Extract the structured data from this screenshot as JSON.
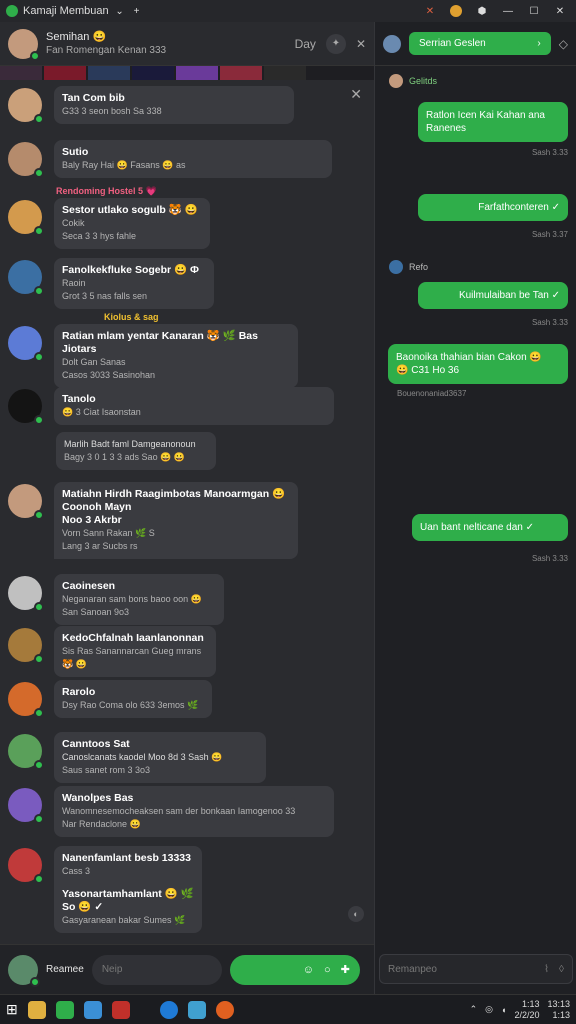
{
  "titlebar": {
    "title": "Kamaji Membuan"
  },
  "left_header": {
    "name": "Semihan 😀",
    "status": "Fan Romengan Kenan 333",
    "day_label": "Day"
  },
  "chats": [
    {
      "name": "Tan Com bib",
      "meta": "G33 3 seon bosh Sa 338",
      "avatar_color": "#caa07a"
    },
    {
      "name": "Sutio",
      "meta": "Baly  Ray Hai 😀 Fasans 😀 as",
      "avatar_color": "#b58b6c"
    },
    {
      "label": "Rendoming Hostel 5 💗"
    },
    {
      "name": "Sestor utlako sogulb 🐯 😀",
      "meta": "Cokik",
      "meta2": "Seca 3 3 hys fahle",
      "avatar_color": "#d39a4d"
    },
    {
      "name": "Fanolkekfluke Sogebr 😀 Ф",
      "meta": "Raoin",
      "meta2": "Grot 3 5 nas falls sen",
      "avatar_color": "#3b6fa3"
    },
    {
      "label": "Kiolus & sag"
    },
    {
      "name": "Ratian mlam yentar Kanaran 🐯 🌿 Bas Jiotars",
      "meta": "Dolt Gan Sanas",
      "meta2": "Casos 3033 Sasinohan",
      "avatar_color": "#5c7bd6"
    },
    {
      "name": "Tanolo",
      "meta": "😀 3 Ciat Isaonstan",
      "avatar_color": "#141414"
    },
    {
      "name": "Marlih Badt faml Damgeanonoun",
      "meta": "Bagy 3 0 1 3 3 ads Sao 😀 😀"
    },
    {
      "name": "Matiahn Hirdh Raagimbotas Manoarmgan 😀",
      "meta": "Coonoh Mayn",
      "meta2": "Noo 3 Akrbr",
      "meta3": "Vorn Sann Rakan 🌿 S",
      "meta4": "Lang 3 ar Sucbs rs",
      "avatar_color": "#c39a7d"
    },
    {
      "name": "Caoinesen",
      "meta": "Neganaran sam bons baoo oon 😀",
      "meta2": "San Sanoan 9o3",
      "avatar_color": "#c0c0c0"
    },
    {
      "name": "KedoChfalnah Iaanlanonnan",
      "meta": "Sis Ras Sanannarcan Gueg mrans 🐯 😀",
      "avatar_color": "#a57a3b"
    },
    {
      "name": "Rarolo",
      "meta": "Dsy  Rao  Coma olo 633 3emos 🌿",
      "avatar_color": "#d46a2b"
    },
    {
      "name": "Canntoos Sat",
      "meta": "Canoslcanats kaodel Moo 8d 3 Sash 😀",
      "meta2": "Saus sanet rom 3 3o3",
      "avatar_color": "#5aa05a"
    },
    {
      "name": "Wanolpes Bas",
      "meta": "Wanomnesemocheaksen sam der bonkaan Iamogenoo 33",
      "meta2": "Nar Rendaclone 😀",
      "avatar_color": "#7a5bbf"
    },
    {
      "name": "Nanenfamlant besb 13333",
      "meta": "Cass 3",
      "meta2": "Yasonartamhamlant 😀 🌿 So 😀 ✓",
      "meta3": "Gasyaranean bakar Sumes 🌿",
      "avatar_color": "#c03a3a"
    }
  ],
  "left_footer": {
    "user": "Reamee",
    "placeholder": "Neip"
  },
  "right_header": {
    "button_label": "Serrian Geslen"
  },
  "right_messages": [
    {
      "text": "Ratlon Icen Kai Kahan ana Ranenes",
      "time": "Sash 3.33"
    },
    {
      "text": "Farfathconteren ✓",
      "time": "Sash 3.37"
    },
    {
      "sender": "Refo"
    },
    {
      "text": "Kuilmulaiban be Tan ✓",
      "time": "Sash 3.33"
    },
    {
      "text": "Baonoika thahian bian Cakon 😀",
      "sub": "😀 C31 Ho 36",
      "time": "Bouenonaniad3637",
      "left": true
    },
    {
      "text": "Uan bant nelticane dan ✓",
      "time": "Sash 3.33"
    }
  ],
  "right_sender_top": "Gelitds",
  "right_footer": {
    "placeholder": "Remanpeo"
  },
  "taskbar": {
    "time": "1:13",
    "date": "2/2/20",
    "time2": "13:13",
    "date2": "1:13"
  }
}
